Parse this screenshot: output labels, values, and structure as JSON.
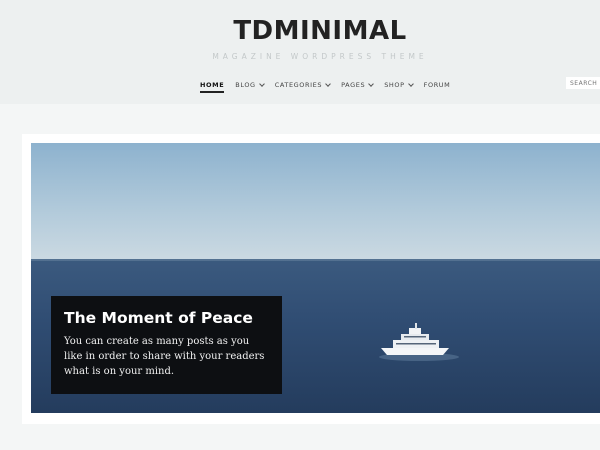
{
  "site": {
    "logo": "TDMINIMAL",
    "tagline": "MAGAZINE WORDPRESS THEME"
  },
  "nav": {
    "items": [
      {
        "label": "HOME",
        "active": true,
        "has_dropdown": false
      },
      {
        "label": "BLOG",
        "active": false,
        "has_dropdown": true
      },
      {
        "label": "CATEGORIES",
        "active": false,
        "has_dropdown": true
      },
      {
        "label": "PAGES",
        "active": false,
        "has_dropdown": true
      },
      {
        "label": "SHOP",
        "active": false,
        "has_dropdown": true
      },
      {
        "label": "FORUM",
        "active": false,
        "has_dropdown": false
      }
    ],
    "search_placeholder": "SEARCH"
  },
  "featured": {
    "title": "The Moment of Peace",
    "excerpt": "You can create as many posts as you like in order to share with your readers what is on your mind."
  },
  "colors": {
    "header_bg": "#edf0f0",
    "page_bg": "#f4f6f6",
    "caption_bg": "#0d0f12",
    "sky_top": "#8eb3cf",
    "sky_bottom": "#c9d8e1",
    "sea": "#2f4b70"
  }
}
